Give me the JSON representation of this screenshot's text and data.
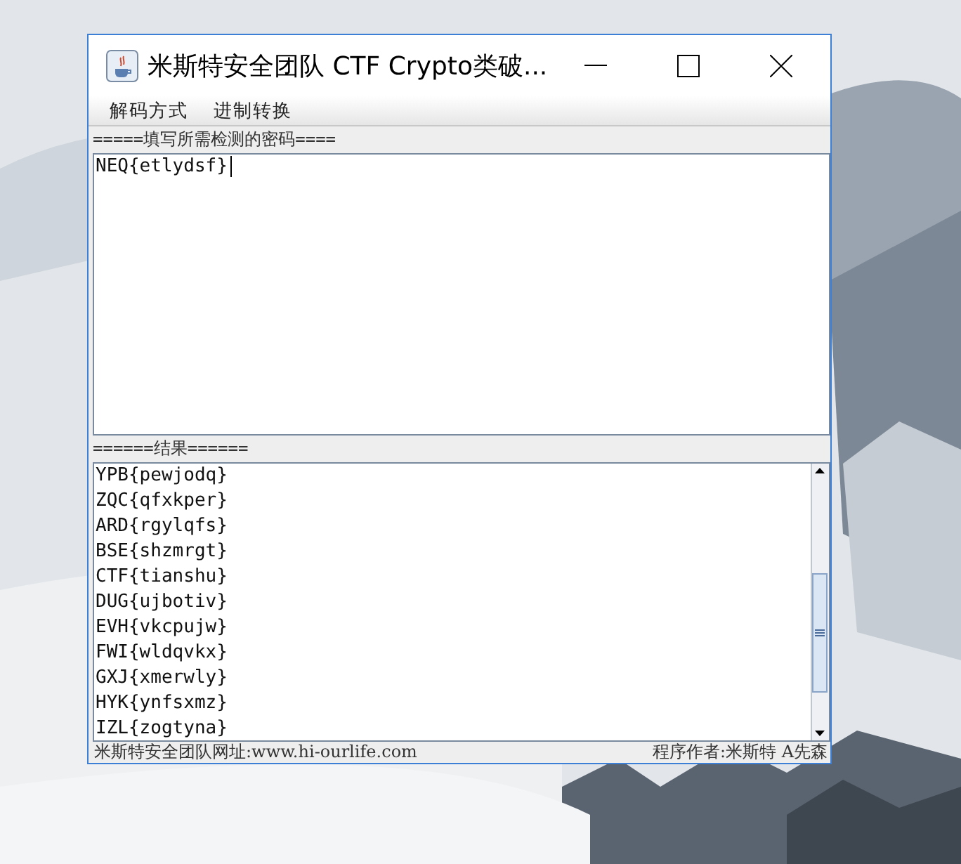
{
  "window": {
    "title": "米斯特安全团队 CTF Crypto类破..."
  },
  "menu": [
    "解码方式",
    "进制转换"
  ],
  "input_section": {
    "label": "=====填写所需检测的密码====",
    "value": "NEQ{etlydsf}"
  },
  "result_section": {
    "label": "======结果======",
    "lines": [
      "YPB{pewjodq}",
      "ZQC{qfxkper}",
      "ARD{rgylqfs}",
      "BSE{shzmrgt}",
      "CTF{tianshu}",
      "DUG{ujbotiv}",
      "EVH{vkcpujw}",
      "FWI{wldqvkx}",
      "GXJ{xmerwly}",
      "HYK{ynfsxmz}",
      "IZL{zogtyna}"
    ]
  },
  "status_bar": {
    "left": "米斯特安全团队网址:www.hi-ourlife.com",
    "right": "程序作者:米斯特 A先森"
  }
}
